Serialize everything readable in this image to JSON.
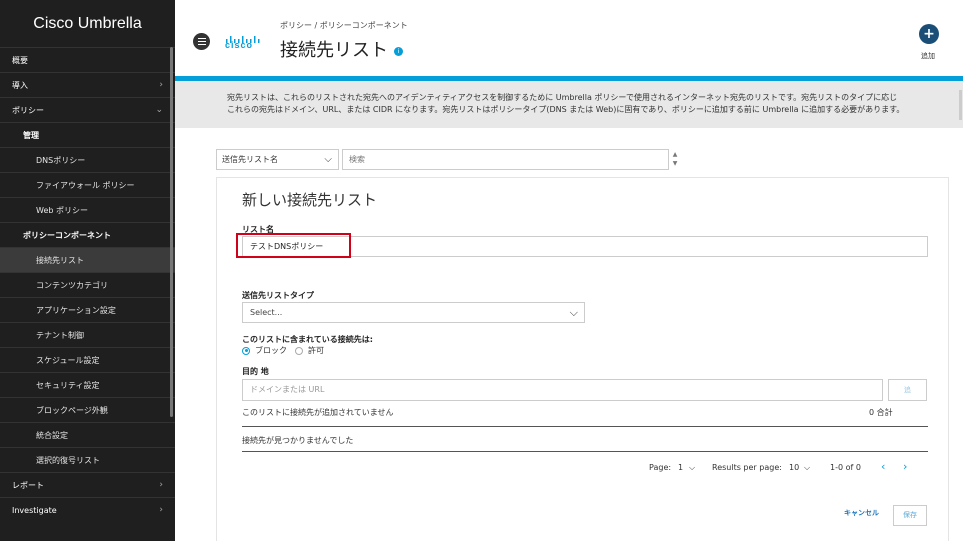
{
  "sidebar": {
    "brand": "Cisco Umbrella",
    "items": [
      {
        "label": "概要",
        "level": 0,
        "chevron": ""
      },
      {
        "label": "導入",
        "level": 0,
        "chevron": "›"
      },
      {
        "label": "ポリシー",
        "level": 0,
        "chevron": "⌄"
      },
      {
        "label": "管理",
        "level": 1,
        "chevron": ""
      },
      {
        "label": "DNSポリシー",
        "level": 2,
        "chevron": ""
      },
      {
        "label": "ファイアウォール ポリシー",
        "level": 2,
        "chevron": ""
      },
      {
        "label": "Web ポリシー",
        "level": 2,
        "chevron": ""
      },
      {
        "label": "ポリシーコンポーネント",
        "level": 1,
        "chevron": ""
      },
      {
        "label": "接続先リスト",
        "level": 2,
        "chevron": "",
        "active": true
      },
      {
        "label": "コンテンツカテゴリ",
        "level": 2,
        "chevron": ""
      },
      {
        "label": "アプリケーション設定",
        "level": 2,
        "chevron": ""
      },
      {
        "label": "テナント制御",
        "level": 2,
        "chevron": ""
      },
      {
        "label": "スケジュール設定",
        "level": 2,
        "chevron": ""
      },
      {
        "label": "セキュリティ設定",
        "level": 2,
        "chevron": ""
      },
      {
        "label": "ブロックページ外観",
        "level": 2,
        "chevron": ""
      },
      {
        "label": "統合設定",
        "level": 2,
        "chevron": ""
      },
      {
        "label": "選択的復号リスト",
        "level": 2,
        "chevron": ""
      },
      {
        "label": "レポート",
        "level": 0,
        "chevron": "›"
      },
      {
        "label": "Investigate",
        "level": 0,
        "chevron": "›"
      }
    ]
  },
  "header": {
    "logo_text": "cisco",
    "breadcrumb": "ポリシー / ポリシーコンポーネント",
    "title": "接続先リスト",
    "info_glyph": "i",
    "add_glyph": "+",
    "add_label": "追加"
  },
  "description": {
    "line1": "宛先リストは、これらのリストされた宛先へのアイデンティティアクセスを制御するために Umbrella ポリシーで使用されるインターネット宛先のリストです。宛先リストのタイプに応じ",
    "line2": "これらの宛先はドメイン、URL、または CIDR になります。宛先リストはポリシータイプ(DNS または Web)に固有であり、ポリシーに追加する前に Umbrella に追加する必要があります。"
  },
  "filter": {
    "select_value": "送信先リスト名",
    "caret": "⌵",
    "search_placeholder": "検索",
    "spinner_up": "▲",
    "spinner_down": "▼"
  },
  "form": {
    "title": "新しい接続先リスト",
    "name_label": "リスト名",
    "name_value": "テストDNSポリシー",
    "type_label": "送信先リストタイプ",
    "type_value": "Select...",
    "type_caret": "⌵",
    "contains_label": "このリストに含まれている接続先は:",
    "radio_block": "ブロック",
    "radio_allow": "許可",
    "dest_label": "目的 地",
    "dest_placeholder": "ドメインまたは URL",
    "dest_add": "追",
    "empty_note": "このリストに接続先が追加されていません",
    "total": "0 合計",
    "not_found": "接続先が見つかりませんでした",
    "pager": {
      "page_label": "Page:",
      "page_value": "1",
      "rpp_label": "Results per page:",
      "rpp_value": "10",
      "caret": "⌵",
      "range": "1-0 of 0",
      "prev": "‹",
      "next": "›"
    },
    "cancel": "キャンセル",
    "save": "保存"
  }
}
